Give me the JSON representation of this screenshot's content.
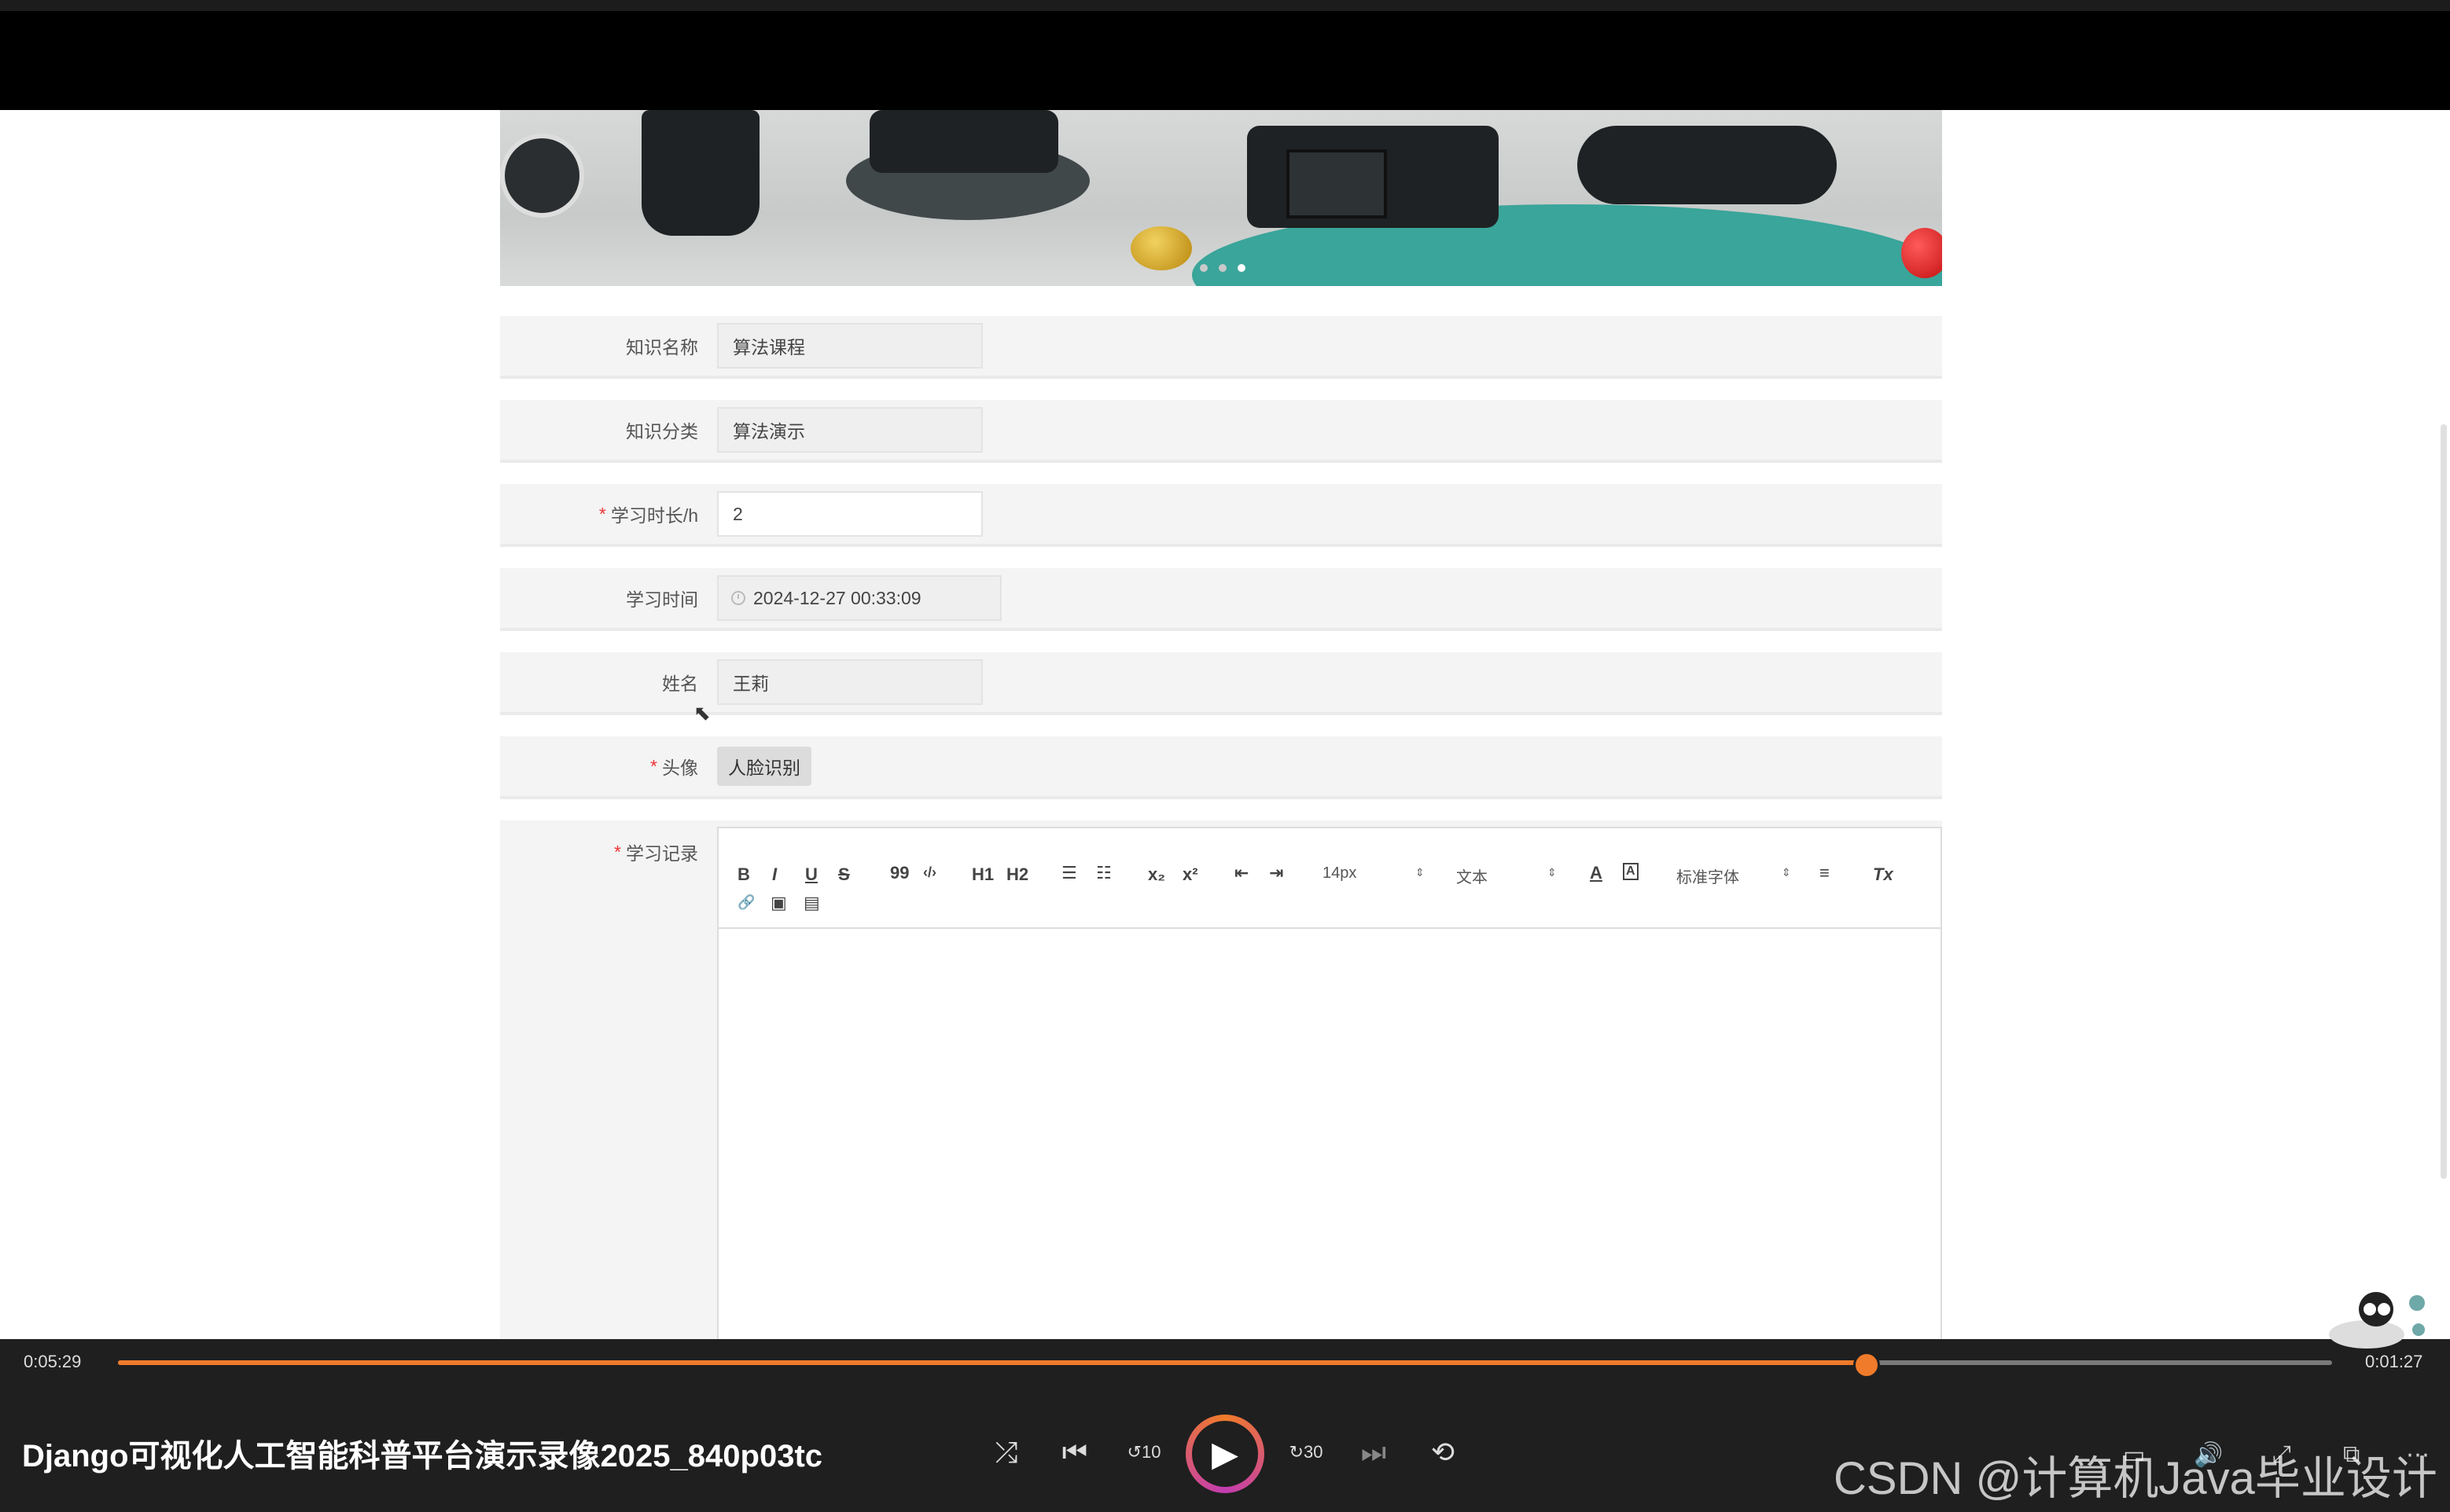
{
  "form": {
    "name_label": "知识名称",
    "name_value": "算法课程",
    "category_label": "知识分类",
    "category_value": "算法演示",
    "duration_label": "学习时长/h",
    "duration_value": "2",
    "time_label": "学习时间",
    "time_value": "2024-12-27 00:33:09",
    "person_label": "姓名",
    "person_value": "王莉",
    "avatar_label": "头像",
    "avatar_button": "人脸识别",
    "record_label": "学习记录",
    "required_mark": "*"
  },
  "editor": {
    "bold": "B",
    "italic": "I",
    "underline": "U",
    "strike": "S",
    "quote": "99",
    "code": "‹/›",
    "h1": "H1",
    "h2": "H2",
    "ol": "☰",
    "ul": "☷",
    "sub": "x₂",
    "sup": "x²",
    "outdent": "⇤",
    "indent": "⇥",
    "font_size": "14px",
    "text_style": "文本",
    "font_color": "A",
    "bg_color": "A",
    "font_family": "标准字体",
    "align": "≡",
    "clear": "Tx",
    "link": "🔗",
    "image": "▣",
    "video": "▤"
  },
  "player": {
    "elapsed": "0:05:29",
    "remaining": "0:01:27",
    "progress": 0.7887,
    "title": "Django可视化人工智能科普平台演示录像2025_840p03tc",
    "rewind_label": "10",
    "forward_label": "30",
    "accent": "#f07b2a"
  },
  "watermark": "CSDN @计算机Java毕业设计"
}
